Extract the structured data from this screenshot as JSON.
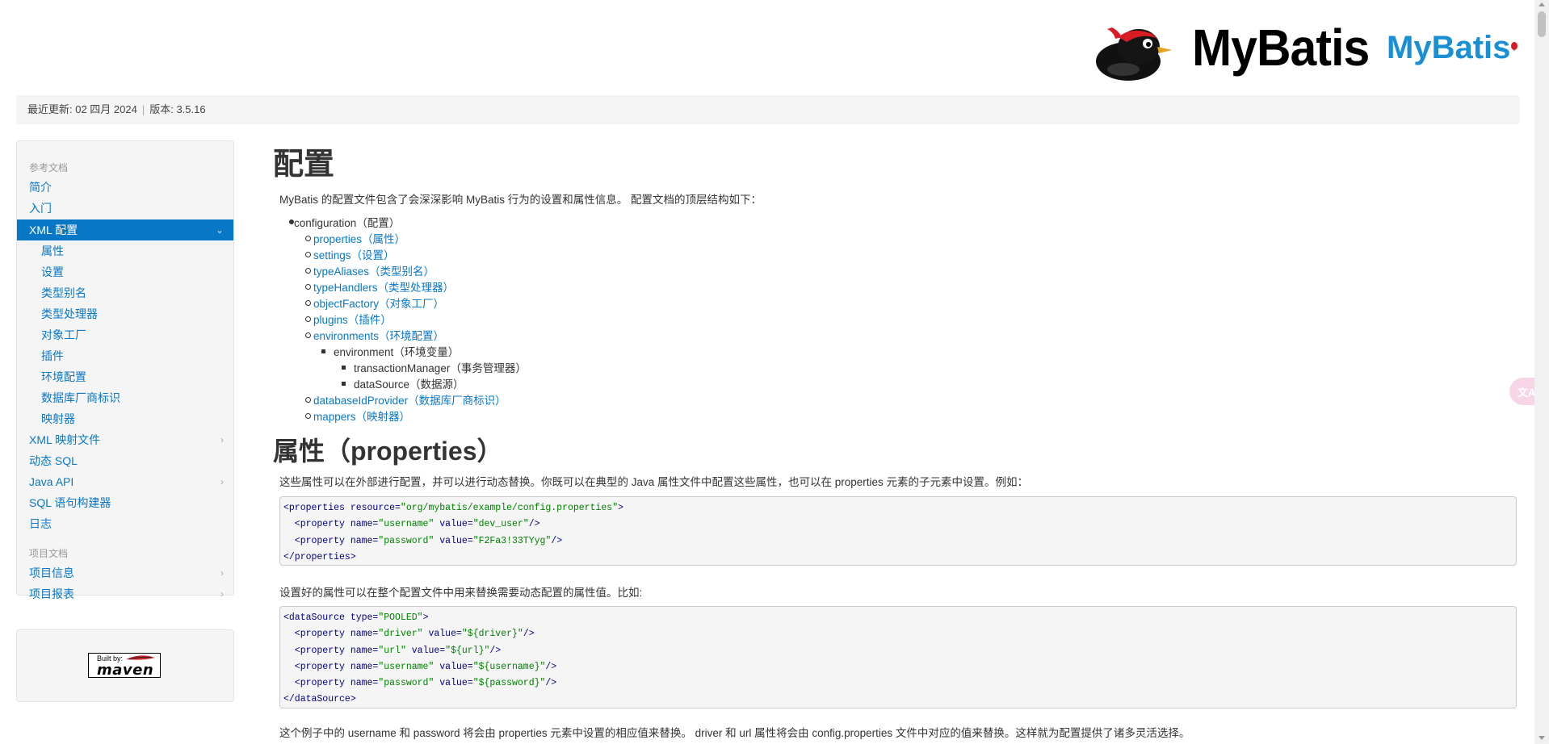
{
  "header": {
    "logo_text": "MyBatis",
    "logo_text_secondary": "MyBatis"
  },
  "breadcrumb": {
    "last_updated": "最近更新: 02 四月 2024",
    "separator": "|",
    "version": "版本: 3.5.16"
  },
  "sidebar": {
    "header_ref": "参考文档",
    "items": [
      {
        "label": "简介"
      },
      {
        "label": "入门"
      },
      {
        "label": "XML 配置",
        "active": true
      },
      {
        "label": "属性"
      },
      {
        "label": "设置"
      },
      {
        "label": "类型别名"
      },
      {
        "label": "类型处理器"
      },
      {
        "label": "对象工厂"
      },
      {
        "label": "插件"
      },
      {
        "label": "环境配置"
      },
      {
        "label": "数据库厂商标识"
      },
      {
        "label": "映射器"
      },
      {
        "label": "XML 映射文件"
      },
      {
        "label": "动态 SQL"
      },
      {
        "label": "Java API"
      },
      {
        "label": "SQL 语句构建器"
      },
      {
        "label": "日志"
      }
    ],
    "header_project": "项目文档",
    "project_items": [
      {
        "label": "项目信息"
      },
      {
        "label": "项目报表"
      }
    ],
    "built_by": "Built by:",
    "maven": "maven"
  },
  "content": {
    "h1": "配置",
    "intro": "MyBatis 的配置文件包含了会深深影响 MyBatis 行为的设置和属性信息。 配置文档的顶层结构如下：",
    "tree": {
      "root": "configuration（配置）",
      "children": [
        "properties（属性）",
        "settings（设置）",
        "typeAliases（类型别名）",
        "typeHandlers（类型处理器）",
        "objectFactory（对象工厂）",
        "plugins（插件）",
        "environments（环境配置）"
      ],
      "env": "environment（环境变量）",
      "env_children": [
        "transactionManager（事务管理器）",
        "dataSource（数据源）"
      ],
      "after": [
        "databaseIdProvider（数据库厂商标识）",
        "mappers（映射器）"
      ]
    },
    "h2": "属性（properties）",
    "para1": "这些属性可以在外部进行配置，并可以进行动态替换。你既可以在典型的 Java 属性文件中配置这些属性，也可以在 properties 元素的子元素中设置。例如：",
    "code1": [
      [
        "<properties ",
        "resource=",
        "\"org/mybatis/example/config.properties\"",
        ">"
      ],
      [
        "  <property ",
        "name=",
        "\"username\"",
        " ",
        "value=",
        "\"dev_user\"",
        "/>"
      ],
      [
        "  <property ",
        "name=",
        "\"password\"",
        " ",
        "value=",
        "\"F2Fa3!33TYyg\"",
        "/>"
      ],
      [
        "</properties>"
      ]
    ],
    "para2": "设置好的属性可以在整个配置文件中用来替换需要动态配置的属性值。比如:",
    "code2": [
      [
        "<dataSource ",
        "type=",
        "\"POOLED\"",
        ">"
      ],
      [
        "  <property ",
        "name=",
        "\"driver\"",
        " ",
        "value=",
        "\"${driver}\"",
        "/>"
      ],
      [
        "  <property ",
        "name=",
        "\"url\"",
        " ",
        "value=",
        "\"${url}\"",
        "/>"
      ],
      [
        "  <property ",
        "name=",
        "\"username\"",
        " ",
        "value=",
        "\"${username}\"",
        "/>"
      ],
      [
        "  <property ",
        "name=",
        "\"password\"",
        " ",
        "value=",
        "\"${password}\"",
        "/>"
      ],
      [
        "</dataSource>"
      ]
    ],
    "para3": "这个例子中的 username 和 password 将会由 properties 元素中设置的相应值来替换。 driver 和 url 属性将会由 config.properties 文件中对应的值来替换。这样就为配置提供了诸多灵活选择。"
  },
  "translate_icon": "文A"
}
